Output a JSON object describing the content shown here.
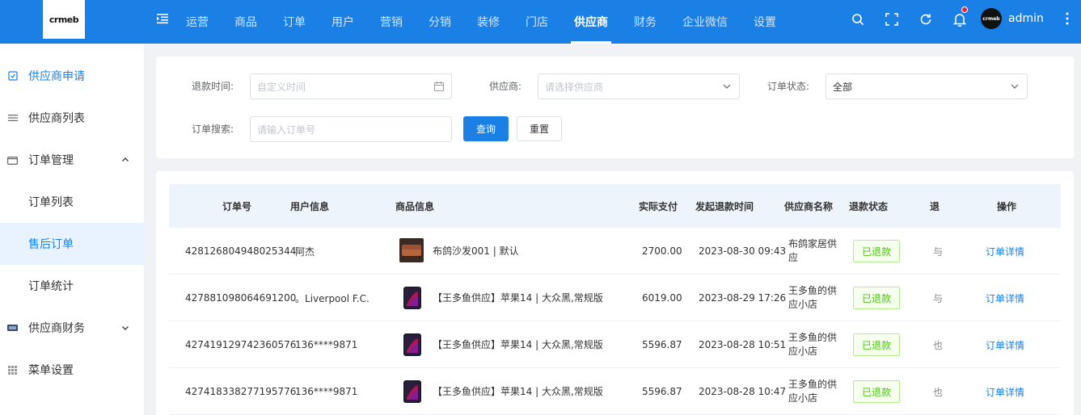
{
  "brand": {
    "logo_text": "crmeb"
  },
  "topnav": {
    "items": [
      "运营",
      "商品",
      "订单",
      "用户",
      "营销",
      "分销",
      "装修",
      "门店",
      "供应商",
      "财务",
      "企业微信",
      "设置"
    ],
    "active_index": 8
  },
  "user": {
    "name": "admin",
    "avatar_text": "crmeb"
  },
  "sidebar": {
    "items": [
      {
        "label": "供应商申请",
        "icon": "check-square-icon"
      },
      {
        "label": "供应商列表",
        "icon": "list-icon"
      },
      {
        "label": "订单管理",
        "icon": "folder-icon"
      },
      {
        "label": "订单列表",
        "icon": ""
      },
      {
        "label": "售后订单",
        "icon": ""
      },
      {
        "label": "订单统计",
        "icon": ""
      },
      {
        "label": "供应商财务",
        "icon": "wallet-icon"
      },
      {
        "label": "菜单设置",
        "icon": "grid-icon"
      }
    ]
  },
  "filters": {
    "refund_time_label": "退款时间:",
    "refund_time_placeholder": "自定义时间",
    "supplier_label": "供应商:",
    "supplier_placeholder": "请选择供应商",
    "status_label": "订单状态:",
    "status_value": "全部",
    "search_label": "订单搜索:",
    "search_placeholder": "请输入订单号",
    "query_button": "查询",
    "reset_button": "重置"
  },
  "table": {
    "headers": [
      "订单号",
      "用户信息",
      "商品信息",
      "实际支付",
      "发起退款时间",
      "供应商名称",
      "退款状态",
      "退",
      "操作"
    ],
    "rows": [
      {
        "order_no": "428126804948025344",
        "user": "阿杰",
        "product": "布鸽沙发001 | 默认",
        "paid": "2700.00",
        "refund_time": "2023-08-30 09:43",
        "supplier": "布鸽家居供应",
        "status": "已退款",
        "extra": "与",
        "action": "订单详情",
        "thumb": "sofa"
      },
      {
        "order_no": "427881098064691200",
        "user": "。Liverpool F.C.",
        "product": "【王多鱼供应】苹果14 | 大众黑,常规版",
        "paid": "6019.00",
        "refund_time": "2023-08-29 17:26",
        "supplier": "王多鱼的供应小店",
        "status": "已退款",
        "extra": "与",
        "action": "订单详情",
        "thumb": "phone"
      },
      {
        "order_no": "427419129742360576",
        "user": "136****9871",
        "product": "【王多鱼供应】苹果14 | 大众黑,常规版",
        "paid": "5596.87",
        "refund_time": "2023-08-28 10:51",
        "supplier": "王多鱼的供应小店",
        "status": "已退款",
        "extra": "也",
        "action": "订单详情",
        "thumb": "phone"
      },
      {
        "order_no": "427418338277195776",
        "user": "136****9871",
        "product": "【王多鱼供应】苹果14 | 大众黑,常规版",
        "paid": "5596.87",
        "refund_time": "2023-08-28 10:47",
        "supplier": "王多鱼的供应小店",
        "status": "已退款",
        "extra": "也",
        "action": "订单详情",
        "thumb": "phone"
      }
    ]
  },
  "colors": {
    "primary": "#1a80e6",
    "success": "#52c41a"
  }
}
